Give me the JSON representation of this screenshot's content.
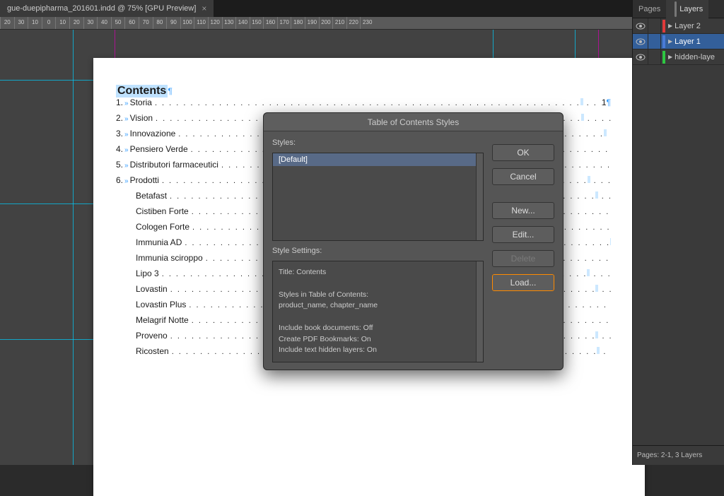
{
  "tab": {
    "title": "gue-duepipharma_201601.indd @ 75% [GPU Preview]"
  },
  "ruler": {
    "ticks": [
      20,
      30,
      10,
      0,
      10,
      20,
      30,
      40,
      50,
      60,
      70,
      80,
      90,
      100,
      110,
      120,
      130,
      140,
      150,
      160,
      170,
      180,
      190,
      200,
      210,
      220,
      230
    ]
  },
  "toc": {
    "title": "Contents",
    "chapters": [
      {
        "n": "1.",
        "label": "Storia",
        "page": "1"
      },
      {
        "n": "2.",
        "label": "Vision"
      },
      {
        "n": "3.",
        "label": "Innovazione"
      },
      {
        "n": "4.",
        "label": "Pensiero Verde"
      },
      {
        "n": "5.",
        "label": "Distributori farmaceutici"
      },
      {
        "n": "6.",
        "label": "Prodotti"
      }
    ],
    "products": [
      "Betafast",
      "Cistiben Forte",
      "Cologen Forte",
      "Immunia AD",
      "Immunia sciroppo",
      "Lipo 3",
      "Lovastin",
      "Lovastin Plus",
      "Melagrif Notte",
      "Proveno",
      "Ricosten"
    ]
  },
  "panel": {
    "tabs": {
      "pages": "Pages",
      "layers": "Layers"
    },
    "layers": [
      {
        "name": "Layer 2",
        "color": "#e03a3a",
        "selected": false,
        "visible": true
      },
      {
        "name": "Layer 1",
        "color": "#4a7bd6",
        "selected": true,
        "visible": true
      },
      {
        "name": "hidden-laye",
        "color": "#2ec742",
        "selected": false,
        "visible": true
      }
    ],
    "footer": "Pages: 2-1, 3 Layers"
  },
  "dialog": {
    "title": "Table of Contents Styles",
    "styles_label": "Styles:",
    "styles_items": [
      "[Default]"
    ],
    "settings_label": "Style Settings:",
    "settings_lines": [
      "Title: Contents",
      "",
      "Styles in Table of Contents:",
      "product_name, chapter_name",
      "",
      "Include book documents: Off",
      "Create PDF Bookmarks: On",
      "Include text hidden layers: On"
    ],
    "buttons": {
      "ok": "OK",
      "cancel": "Cancel",
      "new": "New...",
      "edit": "Edit...",
      "delete": "Delete",
      "load": "Load..."
    }
  }
}
